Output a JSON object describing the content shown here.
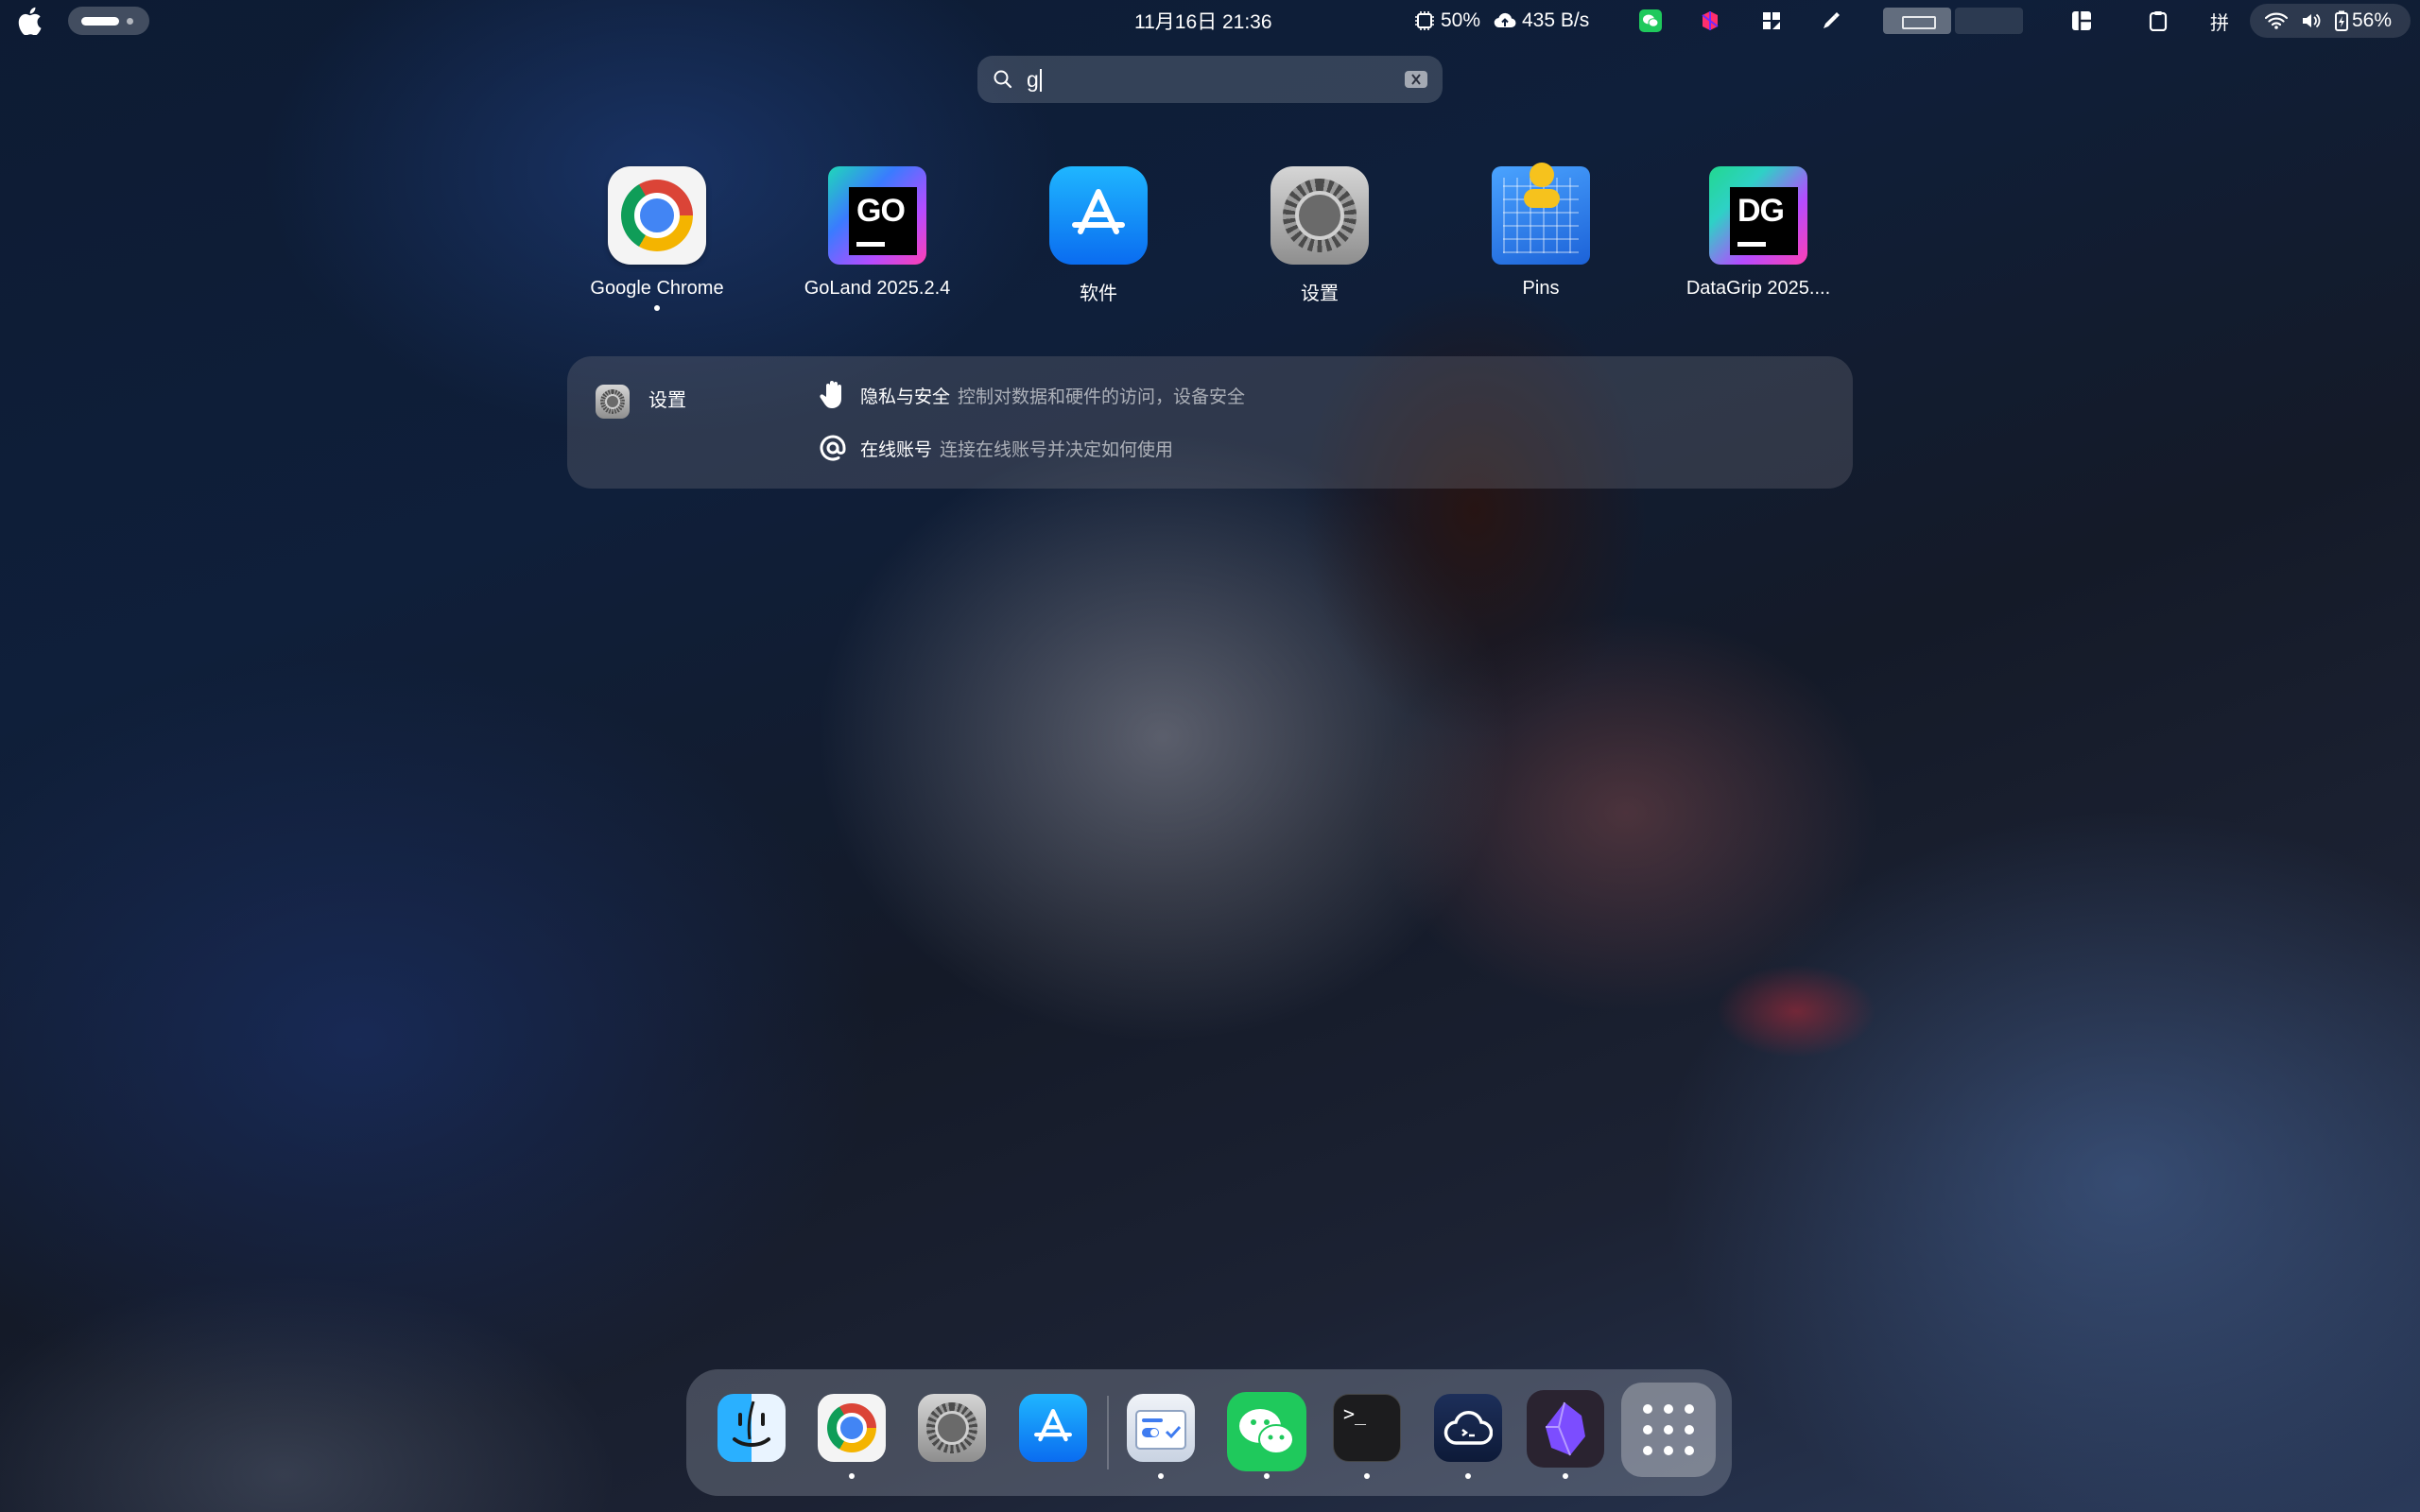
{
  "menubar": {
    "clock": "11月16日  21:36",
    "cpu_percent": "50%",
    "net_speed": "435 B/s",
    "ime": "拼",
    "battery": "56%",
    "cpu_graph_fill": 0.5
  },
  "search": {
    "query": "g"
  },
  "apps": [
    {
      "label": "Google Chrome",
      "running": true
    },
    {
      "label": "GoLand 2025.2.4",
      "running": false,
      "logo": "GO"
    },
    {
      "label": "软件",
      "running": false
    },
    {
      "label": "设置",
      "running": false
    },
    {
      "label": "Pins",
      "running": false
    },
    {
      "label": "DataGrip 2025....",
      "running": false,
      "logo": "DG"
    }
  ],
  "settings_results": {
    "app_name": "设置",
    "rows": [
      {
        "title": "隐私与安全",
        "desc": "控制对数据和硬件的访问，设备安全",
        "icon": "hand-icon"
      },
      {
        "title": "在线账号",
        "desc": "连接在线账号并决定如何使用",
        "icon": "at-icon"
      }
    ]
  },
  "dock": {
    "items": [
      {
        "name": "finder",
        "running": false
      },
      {
        "name": "google-chrome",
        "running": true
      },
      {
        "name": "settings",
        "running": false
      },
      {
        "name": "app-store",
        "running": false
      },
      {
        "name": "clipboard-manager",
        "running": true
      },
      {
        "name": "wechat",
        "running": true
      },
      {
        "name": "terminal",
        "running": true
      },
      {
        "name": "vpn-client",
        "running": true
      },
      {
        "name": "obsidian",
        "running": true
      },
      {
        "name": "launchpad",
        "running": false
      }
    ]
  },
  "colors": {
    "wechat_green": "#1fc95c",
    "appstore_blue": "#0a6cf0",
    "jetbrains_gradient": [
      "#1fd8b8",
      "#3a7bff",
      "#b44cff",
      "#ff3fb2"
    ]
  }
}
